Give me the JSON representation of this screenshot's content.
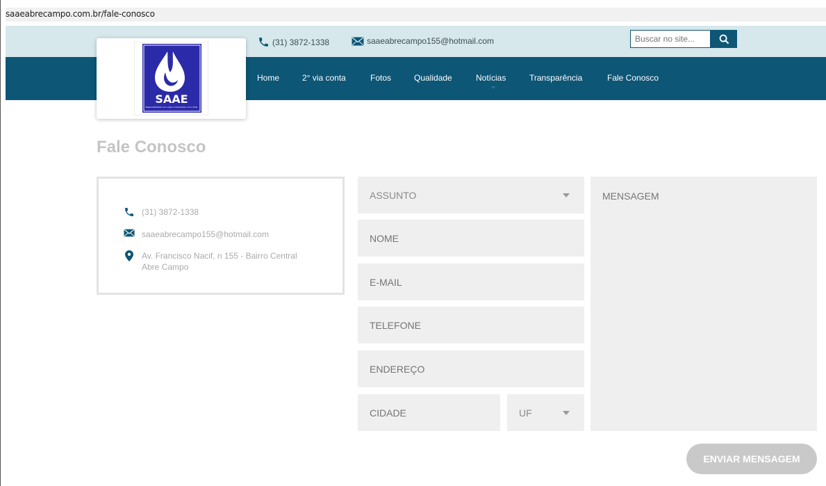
{
  "browser": {
    "url": "saaeabrecampo.com.br/fale-conosco"
  },
  "header": {
    "phone": "(31) 3872-1338",
    "email": "saaeabrecampo155@hotmail.com",
    "search_placeholder": "Buscar no site...",
    "logo_text": "SAAE",
    "logo_tagline": "Responsabilidade com a Água. Compromisso com a Vida!"
  },
  "nav": {
    "items": [
      "Home",
      "2° via conta",
      "Fotos",
      "Qualidade",
      "Notícias",
      "Transparência",
      "Fale Conosco"
    ]
  },
  "page": {
    "title": "Fale Conosco"
  },
  "contact_info": {
    "phone": "(31) 3872-1338",
    "email": "saaeabrecampo155@hotmail.com",
    "address_line1": "Av. Francisco Nacif, n 155 - Bairro Central",
    "address_line2": "Abre Campo"
  },
  "form": {
    "subject": "ASSUNTO",
    "name": "NOME",
    "email": "E-MAIL",
    "phone": "TELEFONE",
    "address": "ENDEREÇO",
    "city": "CIDADE",
    "state": "UF",
    "message": "MENSAGEM",
    "submit": "ENVIAR MENSAGEM"
  },
  "colors": {
    "brand_dark": "#0d5676",
    "topbar": "#d6e8ec",
    "field_bg": "#efefef",
    "button_bg": "#c9c9c9"
  }
}
